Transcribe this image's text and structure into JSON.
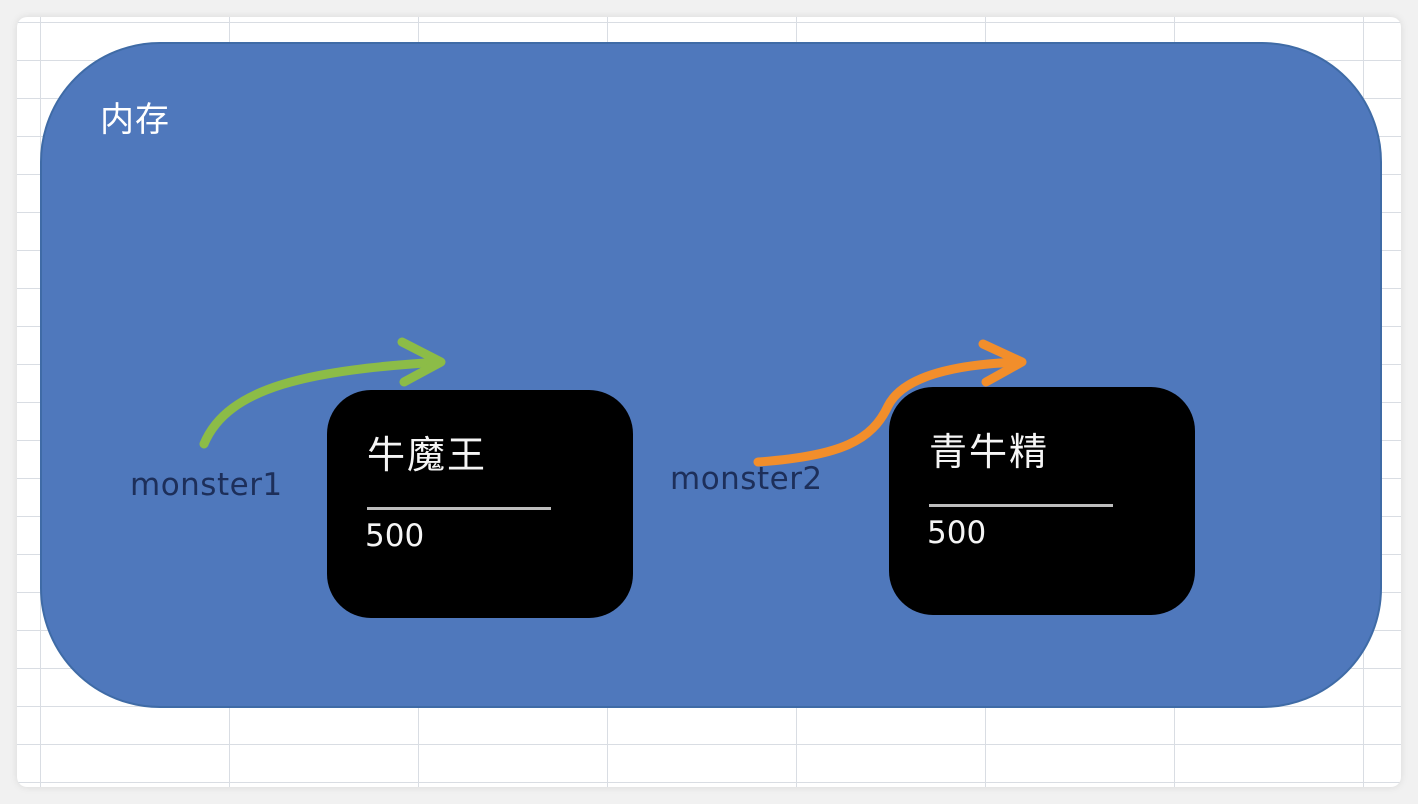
{
  "memory": {
    "label": "内存"
  },
  "references": [
    {
      "variable": "monster1",
      "object_name": "牛魔王",
      "object_value": "500",
      "arrow_color": "#8cbc47"
    },
    {
      "variable": "monster2",
      "object_name": "青牛精",
      "object_value": "500",
      "arrow_color": "#f28e2b"
    }
  ],
  "colors": {
    "memory_fill": "#4f78bc",
    "object_fill": "#000000",
    "variable_text": "#1d2f5a"
  }
}
